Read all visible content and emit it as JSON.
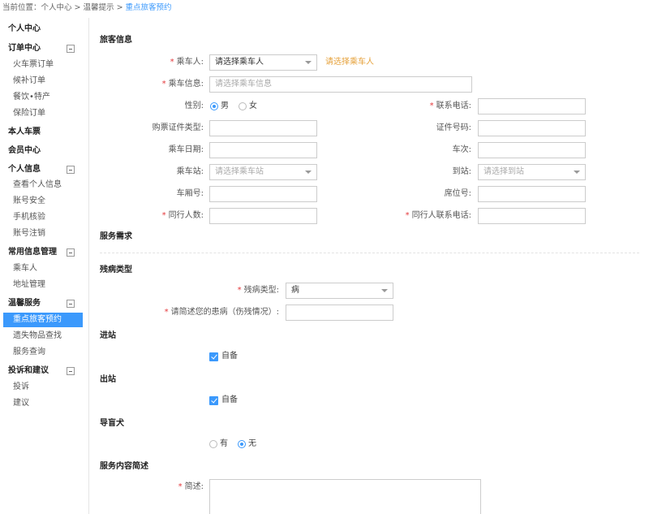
{
  "breadcrumb": {
    "prefix": "当前位置：",
    "items": [
      "个人中心",
      "温馨提示"
    ],
    "sep": " > ",
    "current": "重点旅客预约"
  },
  "sidebar": {
    "c1": "个人中心",
    "c2": "订单中心",
    "c2_items": [
      "火车票订单",
      "候补订单",
      "餐饮•特产",
      "保险订单"
    ],
    "c3": "本人车票",
    "c4": "会员中心",
    "c5": "个人信息",
    "c5_items": [
      "查看个人信息",
      "账号安全",
      "手机核验",
      "账号注销"
    ],
    "c6": "常用信息管理",
    "c6_items": [
      "乘车人",
      "地址管理"
    ],
    "c7": "温馨服务",
    "c7_items": [
      "重点旅客预约",
      "遗失物品查找",
      "服务查询"
    ],
    "c8": "投诉和建议",
    "c8_items": [
      "投诉",
      "建议"
    ]
  },
  "form": {
    "section_passenger": "旅客信息",
    "passenger_label": "乘车人:",
    "passenger_value": "请选择乘车人",
    "passenger_hint": "请选择乘车人",
    "passenger_info_label": "乘车信息:",
    "passenger_info_placeholder": "请选择乘车信息",
    "gender_label": "性别:",
    "gender_male": "男",
    "gender_female": "女",
    "phone_label": "联系电话:",
    "id_type_label": "购票证件类型:",
    "id_no_label": "证件号码:",
    "date_label": "乘车日期:",
    "train_label": "车次:",
    "from_label": "乘车站:",
    "from_placeholder": "请选择乘车站",
    "to_label": "到站:",
    "to_placeholder": "请选择到站",
    "coach_label": "车厢号:",
    "seat_label": "席位号:",
    "companions_label": "同行人数:",
    "companion_phone_label": "同行人联系电话:",
    "section_service": "服务需求",
    "section_disability": "残病类型",
    "disability_label": "残病类型:",
    "disability_value": "病",
    "describe_label": "请简述您的患病（伤残情况）:",
    "section_in": "进站",
    "in_check": "自备",
    "section_out": "出站",
    "out_check": "自备",
    "section_dog": "导盲犬",
    "dog_yes": "有",
    "dog_no": "无",
    "section_summary": "服务内容简述",
    "summary_label": "简述:"
  }
}
